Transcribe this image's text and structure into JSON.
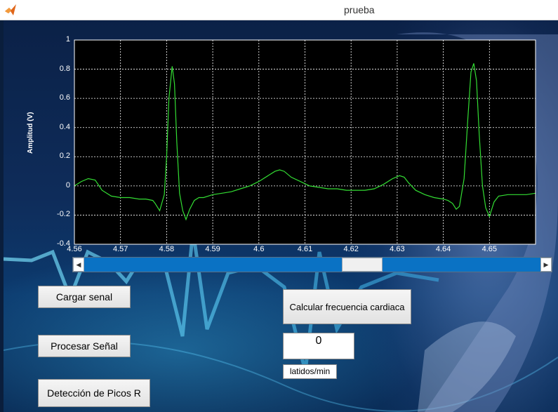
{
  "window": {
    "title": "prueba"
  },
  "plot": {
    "ylabel": "Amplitud (V)",
    "y_ticks": [
      "1",
      "0.8",
      "0.6",
      "0.4",
      "0.2",
      "0",
      "-0.2",
      "-0.4"
    ],
    "x_ticks": [
      "4.56",
      "4.57",
      "4.58",
      "4.59",
      "4.6",
      "4.61",
      "4.62",
      "4.63",
      "4.64",
      "4.65"
    ],
    "line_color": "#33dd33",
    "background": "#000000"
  },
  "chart_data": {
    "type": "line",
    "xlabel": "",
    "ylabel": "Amplitud (V)",
    "xlim": [
      4.56,
      4.66
    ],
    "ylim": [
      -0.4,
      1
    ],
    "grid": true,
    "series": [
      {
        "x": [
          4.56,
          4.5615,
          4.563,
          4.5645,
          4.566,
          4.568,
          4.57,
          4.572,
          4.574,
          4.5755,
          4.577,
          4.5775,
          4.5785,
          4.5795,
          4.58,
          4.5805,
          4.5812,
          4.5817,
          4.5822,
          4.5828,
          4.5835,
          4.5842,
          4.585,
          4.586,
          4.587,
          4.588,
          4.59,
          4.592,
          4.594,
          4.596,
          4.598,
          4.6,
          4.602,
          4.6035,
          4.6045,
          4.6055,
          4.607,
          4.609,
          4.611,
          4.613,
          4.615,
          4.617,
          4.619,
          4.621,
          4.623,
          4.625,
          4.627,
          4.629,
          4.6305,
          4.6315,
          4.6325,
          4.634,
          4.636,
          4.638,
          4.64,
          4.641,
          4.642,
          4.6428,
          4.6435,
          4.6445,
          4.6453,
          4.646,
          4.6466,
          4.6472,
          4.6478,
          4.6485,
          4.6492,
          4.65,
          4.651,
          4.652,
          4.654,
          4.656,
          4.658,
          4.66
        ],
        "y": [
          0.0,
          0.03,
          0.05,
          0.04,
          -0.03,
          -0.07,
          -0.08,
          -0.08,
          -0.09,
          -0.09,
          -0.1,
          -0.12,
          -0.17,
          -0.06,
          0.2,
          0.6,
          0.82,
          0.7,
          0.3,
          -0.05,
          -0.17,
          -0.23,
          -0.16,
          -0.1,
          -0.08,
          -0.08,
          -0.06,
          -0.05,
          -0.04,
          -0.02,
          0.0,
          0.03,
          0.07,
          0.1,
          0.11,
          0.1,
          0.06,
          0.03,
          0.0,
          -0.01,
          -0.02,
          -0.02,
          -0.03,
          -0.03,
          -0.03,
          -0.02,
          0.01,
          0.05,
          0.07,
          0.06,
          0.02,
          -0.03,
          -0.06,
          -0.08,
          -0.09,
          -0.1,
          -0.12,
          -0.16,
          -0.14,
          0.05,
          0.45,
          0.78,
          0.84,
          0.72,
          0.35,
          0.0,
          -0.15,
          -0.21,
          -0.11,
          -0.07,
          -0.06,
          -0.06,
          -0.06,
          -0.05
        ]
      }
    ]
  },
  "scrollbar": {
    "position": 0.62
  },
  "buttons": {
    "load": "Cargar senal",
    "process": "Procesar Señal",
    "detect": "Detección de Picos R",
    "heart_rate": "Calcular frecuencia cardiaca"
  },
  "result": {
    "value": "0",
    "unit": "latidos/min"
  }
}
